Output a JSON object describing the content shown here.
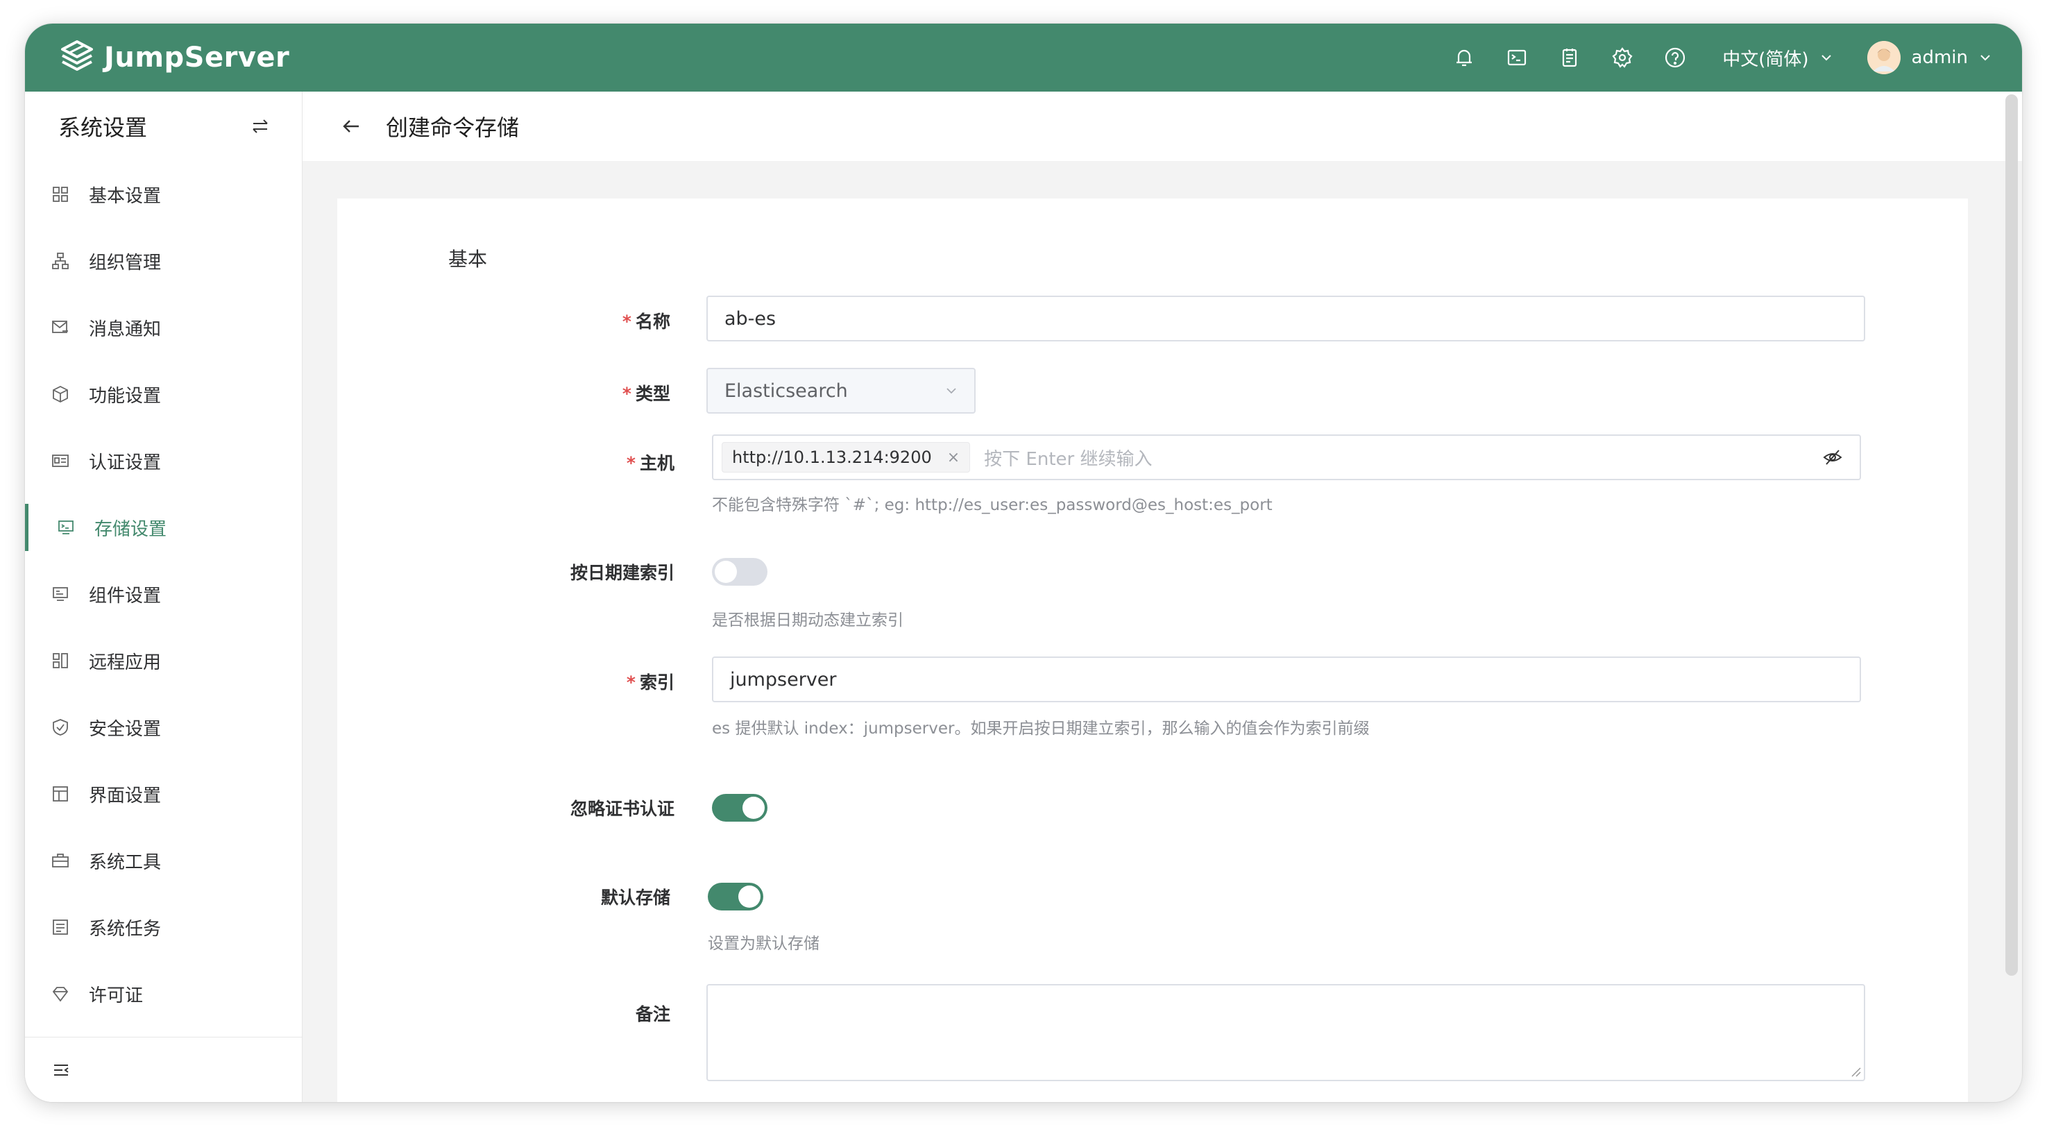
{
  "header": {
    "brand": "JumpServer",
    "icons": [
      "bell-icon",
      "terminal-icon",
      "clipboard-icon",
      "gear-icon",
      "help-icon"
    ],
    "language": "中文(简体)",
    "user": "admin",
    "theme_color": "#43896d"
  },
  "sidebar": {
    "title": "系统设置",
    "items": [
      {
        "label": "基本设置",
        "icon": "grid-icon",
        "active": false
      },
      {
        "label": "组织管理",
        "icon": "org-icon",
        "active": false
      },
      {
        "label": "消息通知",
        "icon": "message-icon",
        "active": false
      },
      {
        "label": "功能设置",
        "icon": "cube-icon",
        "active": false
      },
      {
        "label": "认证设置",
        "icon": "id-card-icon",
        "active": false
      },
      {
        "label": "存储设置",
        "icon": "storage-icon",
        "active": true
      },
      {
        "label": "组件设置",
        "icon": "component-icon",
        "active": false
      },
      {
        "label": "远程应用",
        "icon": "apps-icon",
        "active": false
      },
      {
        "label": "安全设置",
        "icon": "shield-icon",
        "active": false
      },
      {
        "label": "界面设置",
        "icon": "layout-icon",
        "active": false
      },
      {
        "label": "系统工具",
        "icon": "toolbox-icon",
        "active": false
      },
      {
        "label": "系统任务",
        "icon": "task-icon",
        "active": false
      },
      {
        "label": "许可证",
        "icon": "diamond-icon",
        "active": false
      }
    ]
  },
  "page": {
    "title": "创建命令存储",
    "section": "基本"
  },
  "form": {
    "name": {
      "label": "名称",
      "value": "ab-es",
      "required": true
    },
    "type": {
      "label": "类型",
      "value": "Elasticsearch",
      "required": true
    },
    "host": {
      "label": "主机",
      "required": true,
      "tag": "http://10.1.13.214:9200",
      "placeholder": "按下 Enter 继续输入",
      "hint": "不能包含特殊字符 `#`; eg: http://es_user:es_password@es_host:es_port"
    },
    "date_index": {
      "label": "按日期建索引",
      "on": false,
      "hint": "是否根据日期动态建立索引"
    },
    "index": {
      "label": "索引",
      "required": true,
      "value": "jumpserver",
      "hint": "es 提供默认 index：jumpserver。如果开启按日期建立索引，那么输入的值会作为索引前缀"
    },
    "ignore_cert": {
      "label": "忽略证书认证",
      "on": true
    },
    "default_storage": {
      "label": "默认存储",
      "on": true,
      "hint": "设置为默认存储"
    },
    "comment": {
      "label": "备注",
      "value": ""
    }
  }
}
